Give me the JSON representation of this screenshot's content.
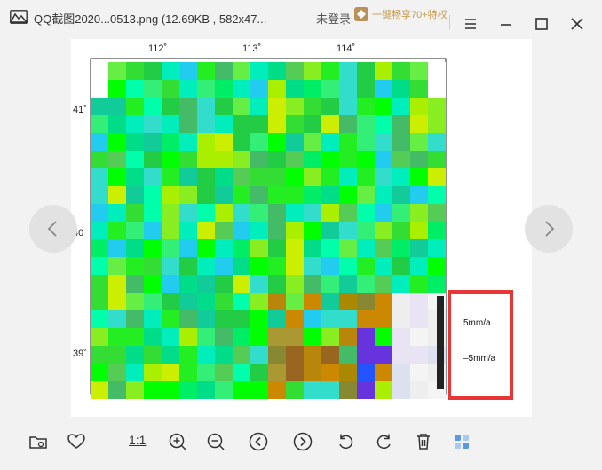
{
  "window": {
    "title": "QQ截图2020...0513.png (12.69KB , 582x47...",
    "login": "未登录",
    "vip_label": "一键畅享70+特权"
  },
  "image": {
    "lon_ticks": [
      "112˚",
      "113˚",
      "114˚"
    ],
    "lat_ticks": [
      "41˚",
      "40",
      "39˚"
    ],
    "legend_top": "5mm/a",
    "legend_bottom": "–5mm/a"
  },
  "toolbar": {
    "ratio_label": "1:1"
  },
  "colors": {
    "accent_red": "#e83535",
    "nav_bg": "#e2e2e2",
    "active_blue": "#5a9be0"
  }
}
